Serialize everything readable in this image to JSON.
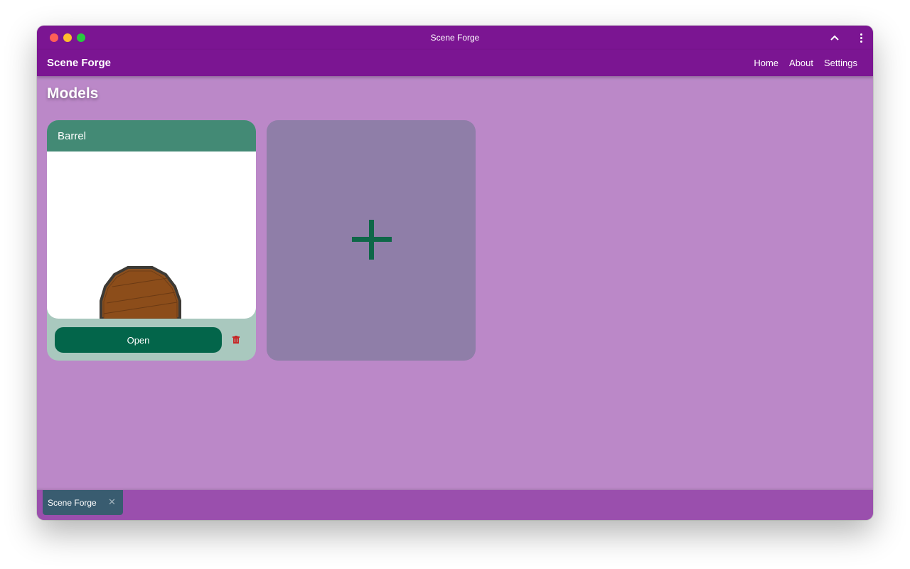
{
  "window": {
    "title": "Scene Forge"
  },
  "appbar": {
    "brand": "Scene Forge",
    "nav": [
      "Home",
      "About",
      "Settings"
    ]
  },
  "page": {
    "title": "Models"
  },
  "models": [
    {
      "name": "Barrel",
      "open_label": "Open"
    }
  ],
  "taskbar": {
    "tab_label": "Scene Forge",
    "close_glyph": "✕"
  },
  "colors": {
    "primary": "#7b1592",
    "background": "#bb88c8",
    "card_header": "#438a75",
    "card_footer": "#a9c8be",
    "button": "#03654a",
    "add_card": "#8f7ea8",
    "delete": "#c62828"
  },
  "icons": {
    "titlebar": [
      "chevron-up-icon",
      "more-vert-icon"
    ],
    "card": [
      "trash-icon"
    ],
    "add": "plus-icon"
  }
}
